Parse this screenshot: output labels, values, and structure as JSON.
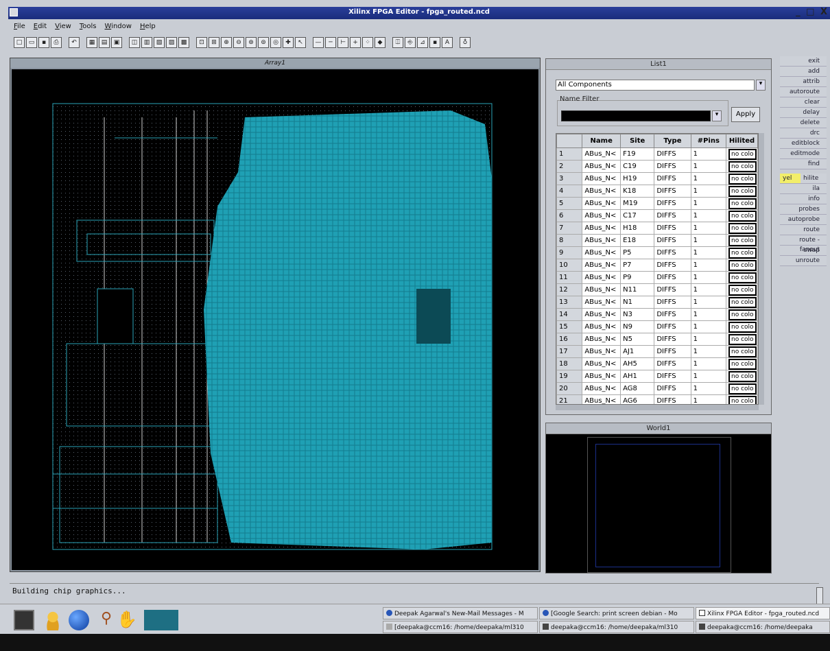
{
  "window": {
    "title": "Xilinx FPGA Editor - fpga_routed.ncd",
    "controls": "_ □ X"
  },
  "menu": [
    "File",
    "Edit",
    "View",
    "Tools",
    "Window",
    "Help"
  ],
  "panels": {
    "array": {
      "title": "Array1"
    },
    "list": {
      "title": "List1",
      "category": "All Components",
      "name_filter_label": "Name Filter",
      "name_filter_value": "",
      "apply_label": "Apply",
      "columns": [
        "",
        "Name",
        "Site",
        "Type",
        "#Pins",
        "Hilited"
      ],
      "rows": [
        [
          "1",
          "ABus_N<",
          "F19",
          "DIFFS",
          "1",
          "no colo"
        ],
        [
          "2",
          "ABus_N<",
          "C19",
          "DIFFS",
          "1",
          "no colo"
        ],
        [
          "3",
          "ABus_N<",
          "H19",
          "DIFFS",
          "1",
          "no colo"
        ],
        [
          "4",
          "ABus_N<",
          "K18",
          "DIFFS",
          "1",
          "no colo"
        ],
        [
          "5",
          "ABus_N<",
          "M19",
          "DIFFS",
          "1",
          "no colo"
        ],
        [
          "6",
          "ABus_N<",
          "C17",
          "DIFFS",
          "1",
          "no colo"
        ],
        [
          "7",
          "ABus_N<",
          "H18",
          "DIFFS",
          "1",
          "no colo"
        ],
        [
          "8",
          "ABus_N<",
          "E18",
          "DIFFS",
          "1",
          "no colo"
        ],
        [
          "9",
          "ABus_N<",
          "P5",
          "DIFFS",
          "1",
          "no colo"
        ],
        [
          "10",
          "ABus_N<",
          "P7",
          "DIFFS",
          "1",
          "no colo"
        ],
        [
          "11",
          "ABus_N<",
          "P9",
          "DIFFS",
          "1",
          "no colo"
        ],
        [
          "12",
          "ABus_N<",
          "N11",
          "DIFFS",
          "1",
          "no colo"
        ],
        [
          "13",
          "ABus_N<",
          "N1",
          "DIFFS",
          "1",
          "no colo"
        ],
        [
          "14",
          "ABus_N<",
          "N3",
          "DIFFS",
          "1",
          "no colo"
        ],
        [
          "15",
          "ABus_N<",
          "N9",
          "DIFFS",
          "1",
          "no colo"
        ],
        [
          "16",
          "ABus_N<",
          "N5",
          "DIFFS",
          "1",
          "no colo"
        ],
        [
          "17",
          "ABus_N<",
          "AJ1",
          "DIFFS",
          "1",
          "no colo"
        ],
        [
          "18",
          "ABus_N<",
          "AH5",
          "DIFFS",
          "1",
          "no colo"
        ],
        [
          "19",
          "ABus_N<",
          "AH1",
          "DIFFS",
          "1",
          "no colo"
        ],
        [
          "20",
          "ABus_N<",
          "AG8",
          "DIFFS",
          "1",
          "no colo"
        ],
        [
          "21",
          "ABus_N<",
          "AG6",
          "DIFFS",
          "1",
          "no colo"
        ]
      ]
    },
    "world": {
      "title": "World1"
    }
  },
  "commands": [
    "exit",
    "add",
    "attrib",
    "autoroute",
    "clear",
    "delay",
    "delete",
    "drc",
    "editblock",
    "editmode",
    "find",
    "yel",
    "hilite",
    "ila",
    "info",
    "probes",
    "autoprobe",
    "route",
    "route -fanout",
    "swap",
    "unroute"
  ],
  "status": "Building chip graphics...",
  "taskbar": {
    "tasks_top": [
      "Deepak Agarwal's New-Mail Messages - M",
      "[Google Search: print screen debian - Mo",
      "Xilinx FPGA Editor - fpga_routed.ncd"
    ],
    "tasks_bottom": [
      "[deepaka@ccm16: /home/deepaka/ml310",
      "deepaka@ccm16: /home/deepaka/ml310",
      "deepaka@ccm16: /home/deepaka"
    ]
  },
  "colors": {
    "routing": "#1fa0b4",
    "titlebar": "#1a2c7c",
    "highlight": "#f2ee6a"
  }
}
